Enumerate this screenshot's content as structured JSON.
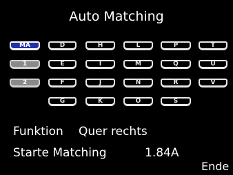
{
  "title": "Auto Matching",
  "left_keys": [
    {
      "label": "MA",
      "state": "selected"
    },
    {
      "label": "1",
      "state": "grey"
    },
    {
      "label": "2",
      "state": "grey"
    }
  ],
  "letter_keys": {
    "col1": [
      "D",
      "E",
      "F",
      "G"
    ],
    "col2": [
      "H",
      "I",
      "J",
      "K"
    ],
    "col3": [
      "L",
      "M",
      "N",
      "O"
    ],
    "col4": [
      "P",
      "Q",
      "R",
      "S"
    ],
    "col5": [
      "T",
      "U",
      "V"
    ]
  },
  "funktion_label": "Funktion",
  "funktion_value": "Quer rechts",
  "starte_label": "Starte Matching",
  "current_value": "1.84A",
  "end_label": "Ende",
  "colors": {
    "selected": "#2233aa",
    "grey": "#8a8a8a",
    "background": "#000000"
  }
}
